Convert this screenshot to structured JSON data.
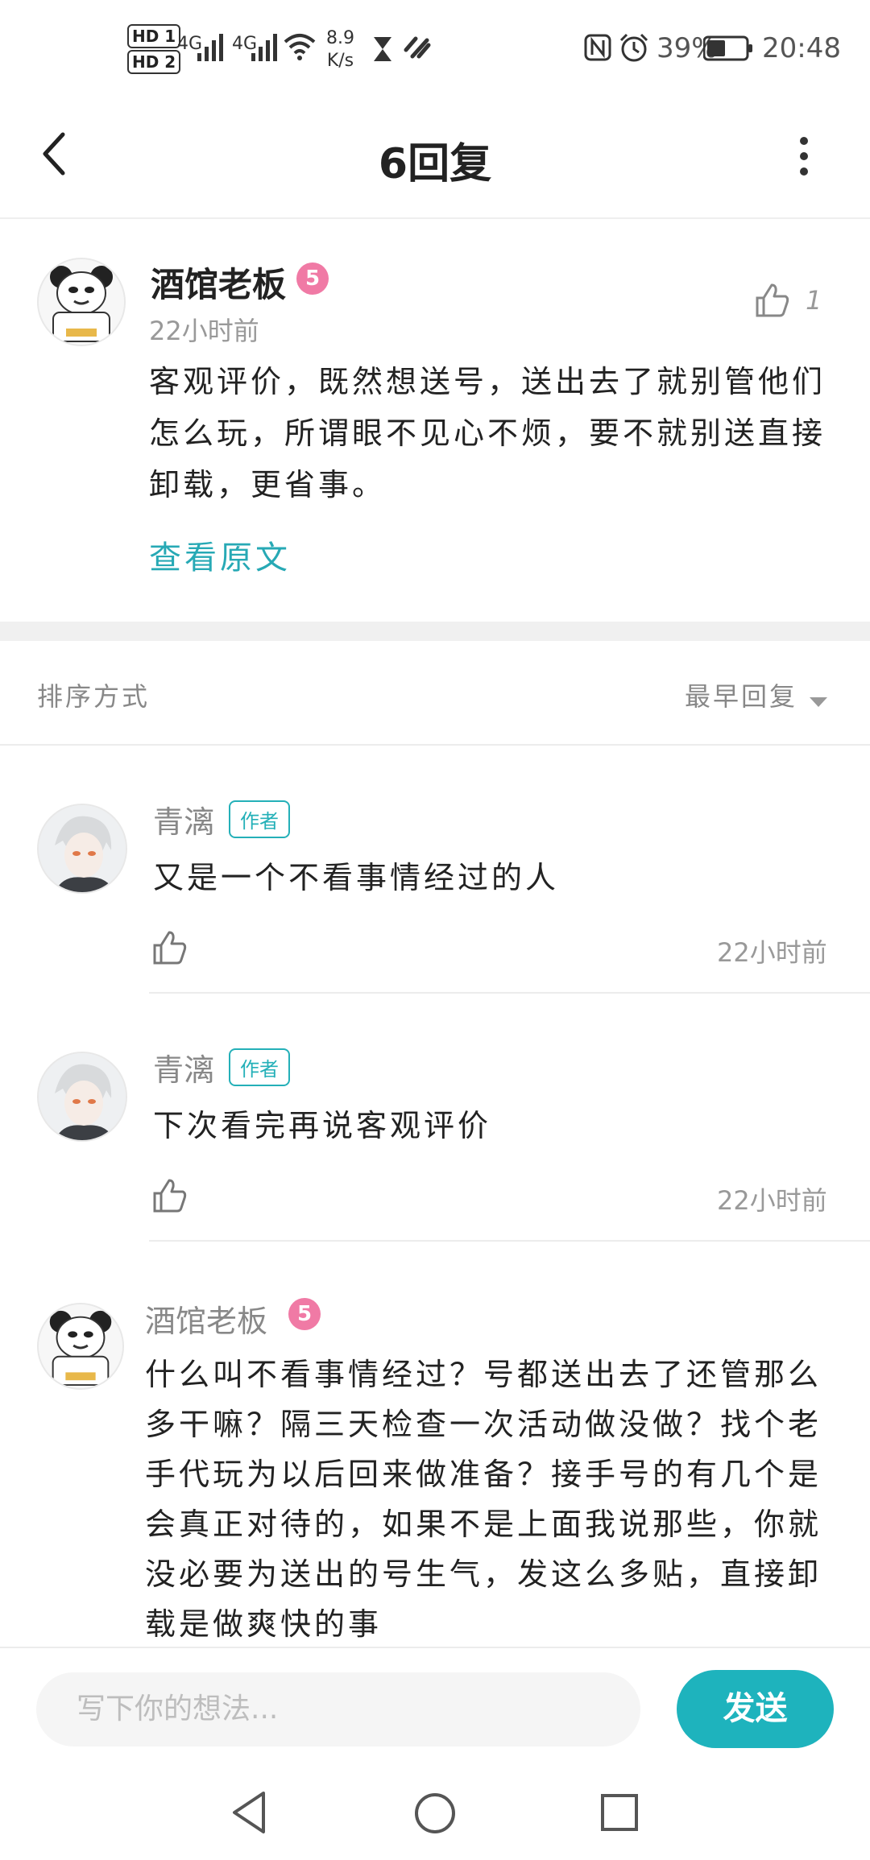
{
  "status_bar": {
    "hd1": "HD 1",
    "hd2": "HD 2",
    "net1": "4G",
    "net2": "4G",
    "speed_value": "8.9",
    "speed_unit": "K/s",
    "battery": "39%",
    "time": "20:48"
  },
  "header": {
    "title": "6回复"
  },
  "post": {
    "username": "酒馆老板",
    "level": "5",
    "time": "22小时前",
    "likes": "1",
    "content": "客观评价，既然想送号，送出去了就别管他们怎么玩，所谓眼不见心不烦，要不就别送直接卸载，更省事。",
    "view_original": "查看原文"
  },
  "sort": {
    "label": "排序方式",
    "value": "最早回复"
  },
  "replies": [
    {
      "username": "青漓",
      "tag": "作者",
      "content": "又是一个不看事情经过的人",
      "time": "22小时前"
    },
    {
      "username": "青漓",
      "tag": "作者",
      "content": "下次看完再说客观评价",
      "time": "22小时前"
    },
    {
      "username": "酒馆老板",
      "level": "5",
      "content": "什么叫不看事情经过？号都送出去了还管那么多干嘛？隔三天检查一次活动做没做？找个老手代玩为以后回来做准备？接手号的有几个是会真正对待的，如果不是上面我说那些，你就没必要为送出的号生气，发这么多贴，直接卸载是做爽快的事"
    }
  ],
  "composer": {
    "placeholder": "写下你的想法...",
    "send": "发送"
  },
  "colors": {
    "accent": "#1eb3bd",
    "link": "#27a9b5",
    "badge": "#f07aa5"
  }
}
